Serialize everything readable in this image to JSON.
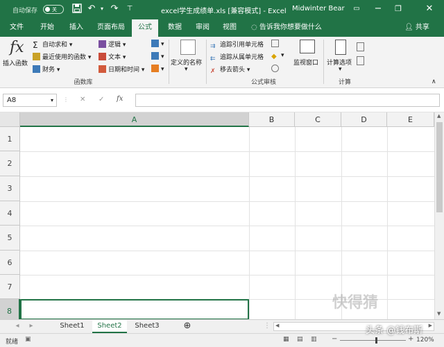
{
  "titlebar": {
    "autosave_label": "自动保存",
    "autosave_state": "关",
    "title": "excel学生成绩单.xls  [兼容模式]  -  Excel",
    "user": "Midwinter Bear"
  },
  "tabs": [
    {
      "label": "文件"
    },
    {
      "label": "开始"
    },
    {
      "label": "插入"
    },
    {
      "label": "页面布局"
    },
    {
      "label": "公式",
      "active": true
    },
    {
      "label": "数据"
    },
    {
      "label": "审阅"
    },
    {
      "label": "视图"
    }
  ],
  "tell_me": "告诉我你想要做什么",
  "share": "共享",
  "ribbon": {
    "insert_function": "插入函数",
    "autosum": "自动求和",
    "recent": "最近使用的函数",
    "financial": "财务",
    "logical": "逻辑",
    "text": "文本",
    "datetime": "日期和时间",
    "defined_names": "定义的名称",
    "trace_precedents": "追踪引用单元格",
    "trace_dependents": "追踪从属单元格",
    "remove_arrows": "移去箭头",
    "watch_window": "监视窗口",
    "calc_options": "计算选项",
    "group_function_library": "函数库",
    "group_formula_auditing": "公式审核",
    "group_calculation": "计算"
  },
  "formula_bar": {
    "name_box": "A8",
    "fx": "fx",
    "value": ""
  },
  "grid": {
    "columns": [
      "A",
      "B",
      "C",
      "D",
      "E"
    ],
    "rows": [
      "1",
      "2",
      "3",
      "4",
      "5",
      "6",
      "7",
      "8"
    ],
    "selected_cell": "A8"
  },
  "sheets": [
    {
      "label": "Sheet1"
    },
    {
      "label": "Sheet2",
      "active": true
    },
    {
      "label": "Sheet3"
    }
  ],
  "status": {
    "ready": "就绪",
    "zoom": "120%"
  },
  "watermarks": {
    "primary": "快得猜",
    "secondary": "头条 @钱布斯"
  },
  "colors": {
    "accent": "#217346"
  }
}
